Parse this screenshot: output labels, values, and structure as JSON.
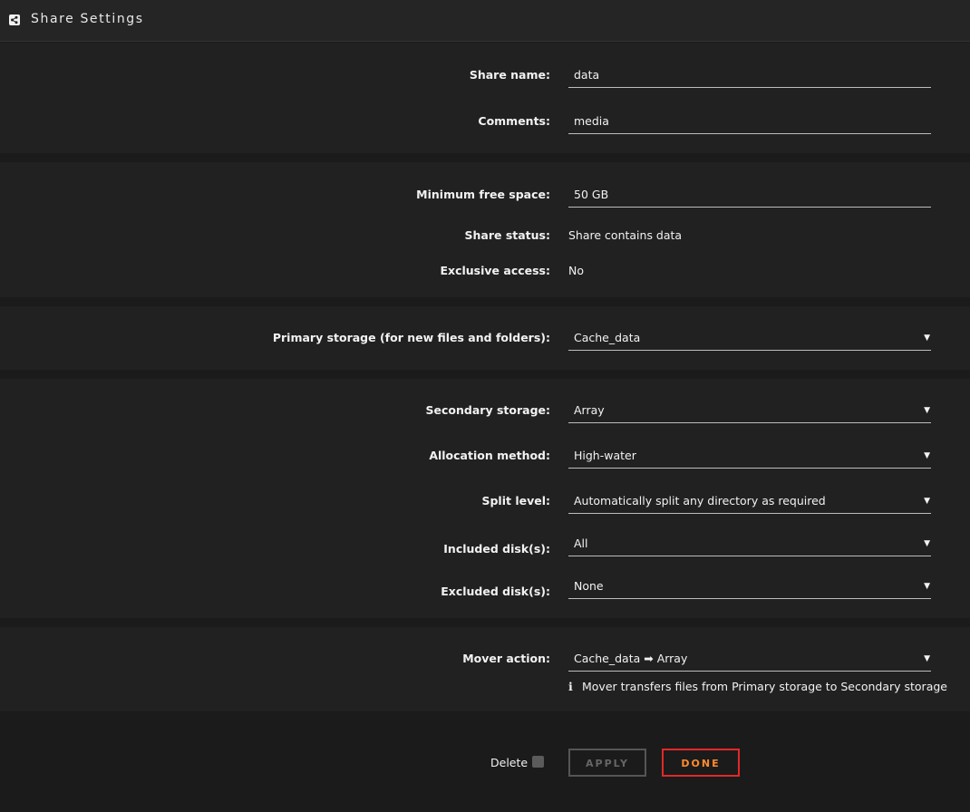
{
  "header": {
    "title": "Share Settings",
    "icon": "share-icon"
  },
  "basic": {
    "share_name_label": "Share name:",
    "share_name_value": "data",
    "comments_label": "Comments:",
    "comments_value": "media"
  },
  "space": {
    "min_free_label": "Minimum free space:",
    "min_free_value": "50 GB",
    "status_label": "Share status:",
    "status_value": "Share contains data",
    "exclusive_label": "Exclusive access:",
    "exclusive_value": "No"
  },
  "primary": {
    "label": "Primary storage (for new files and folders):",
    "value": "Cache_data"
  },
  "secondary": {
    "secondary_label": "Secondary storage:",
    "secondary_value": "Array",
    "allocation_label": "Allocation method:",
    "allocation_value": "High-water",
    "split_label": "Split level:",
    "split_value": "Automatically split any directory as required",
    "included_label": "Included disk(s):",
    "included_value": "All",
    "excluded_label": "Excluded disk(s):",
    "excluded_value": "None"
  },
  "mover": {
    "label": "Mover action:",
    "value": "Cache_data ➡ Array",
    "info_text": "Mover transfers files from Primary storage to Secondary storage"
  },
  "footer": {
    "delete_label": "Delete",
    "delete_checked": false,
    "apply_label": "APPLY",
    "done_label": "DONE"
  },
  "colors": {
    "accent_border": "#e22828",
    "accent_text": "#ff8c2f"
  }
}
